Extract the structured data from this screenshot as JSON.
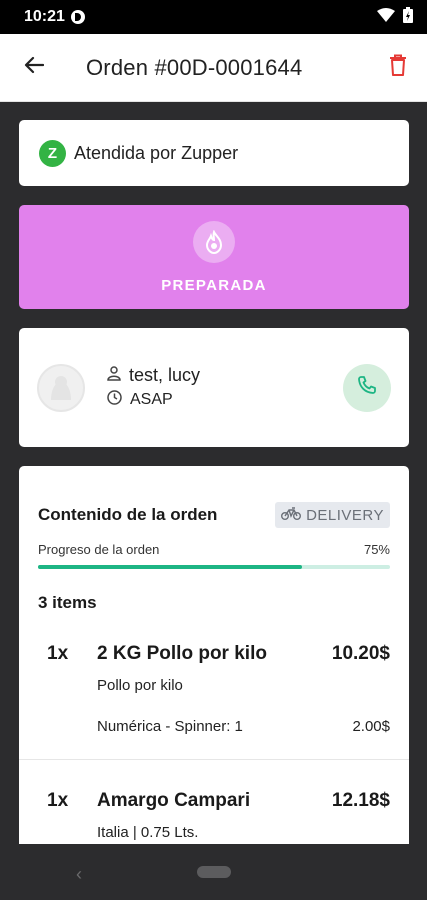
{
  "status_bar": {
    "time": "10:21"
  },
  "app_bar": {
    "title": "Orden #00D-0001644"
  },
  "attended": {
    "icon_letter": "Z",
    "text": "Atendida por Zupper"
  },
  "order_status": {
    "label": "PREPARADA",
    "color": "#e181ec"
  },
  "customer": {
    "name": "test, lucy",
    "time": "ASAP"
  },
  "order": {
    "title": "Contenido de la orden",
    "delivery_badge": "DELIVERY",
    "progress_label": "Progreso de la orden",
    "progress_text": "75%",
    "progress_value": 0.75,
    "items_count": "3 items",
    "items": [
      {
        "qty": "1x",
        "name": "2 KG Pollo por kilo",
        "price": "10.20$",
        "description": "Pollo por kilo",
        "option_label": "Numérica - Spinner: 1",
        "option_price": "2.00$"
      },
      {
        "qty": "1x",
        "name": "Amargo Campari",
        "price": "12.18$",
        "description": "Italia | 0.75 Lts."
      }
    ]
  },
  "colors": {
    "accent_green": "#1db584",
    "delete_red": "#e53935",
    "zupper_green": "#33b344"
  }
}
